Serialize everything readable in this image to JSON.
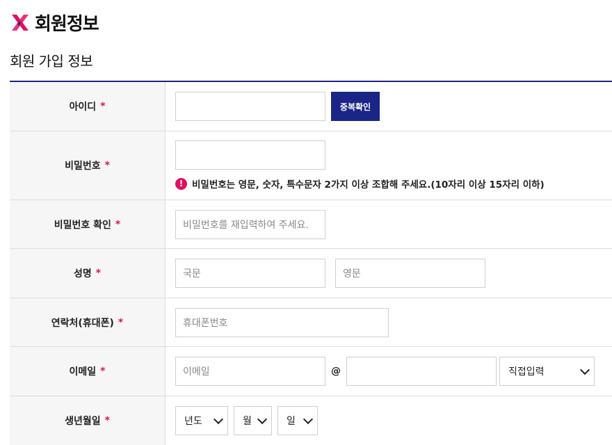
{
  "header": {
    "brand_icon": "x-brand-icon",
    "brand_color": "#e0105e",
    "page_title": "회원정보"
  },
  "section": {
    "title": "회원 가입 정보"
  },
  "colors": {
    "accent": "#1b2585",
    "required": "#e0105e"
  },
  "form": {
    "required_mark": "*",
    "id": {
      "label": "아이디",
      "input_value": "",
      "check_button": "중복확인"
    },
    "password": {
      "label": "비밀번호",
      "input_value": "",
      "notice_icon": "exclamation-icon",
      "notice_icon_glyph": "!",
      "notice": "비밀번호는 영문, 숫자, 특수문자 2가지 이상 조합해 주세요.(10자리 이상 15자리 이하)"
    },
    "password_confirm": {
      "label": "비밀번호 확인",
      "placeholder": "비밀번호를 재입력하여 주세요."
    },
    "name": {
      "label": "성명",
      "korean_placeholder": "국문",
      "english_placeholder": "영문"
    },
    "phone": {
      "label": "연락처(휴대폰)",
      "placeholder": "휴대폰번호"
    },
    "email": {
      "label": "이메일",
      "local_placeholder": "이메일",
      "at_symbol": "@",
      "domain_value": "",
      "domain_select": "직접입력"
    },
    "birthday": {
      "label": "생년월일",
      "year": "년도",
      "month": "월",
      "day": "일"
    }
  }
}
